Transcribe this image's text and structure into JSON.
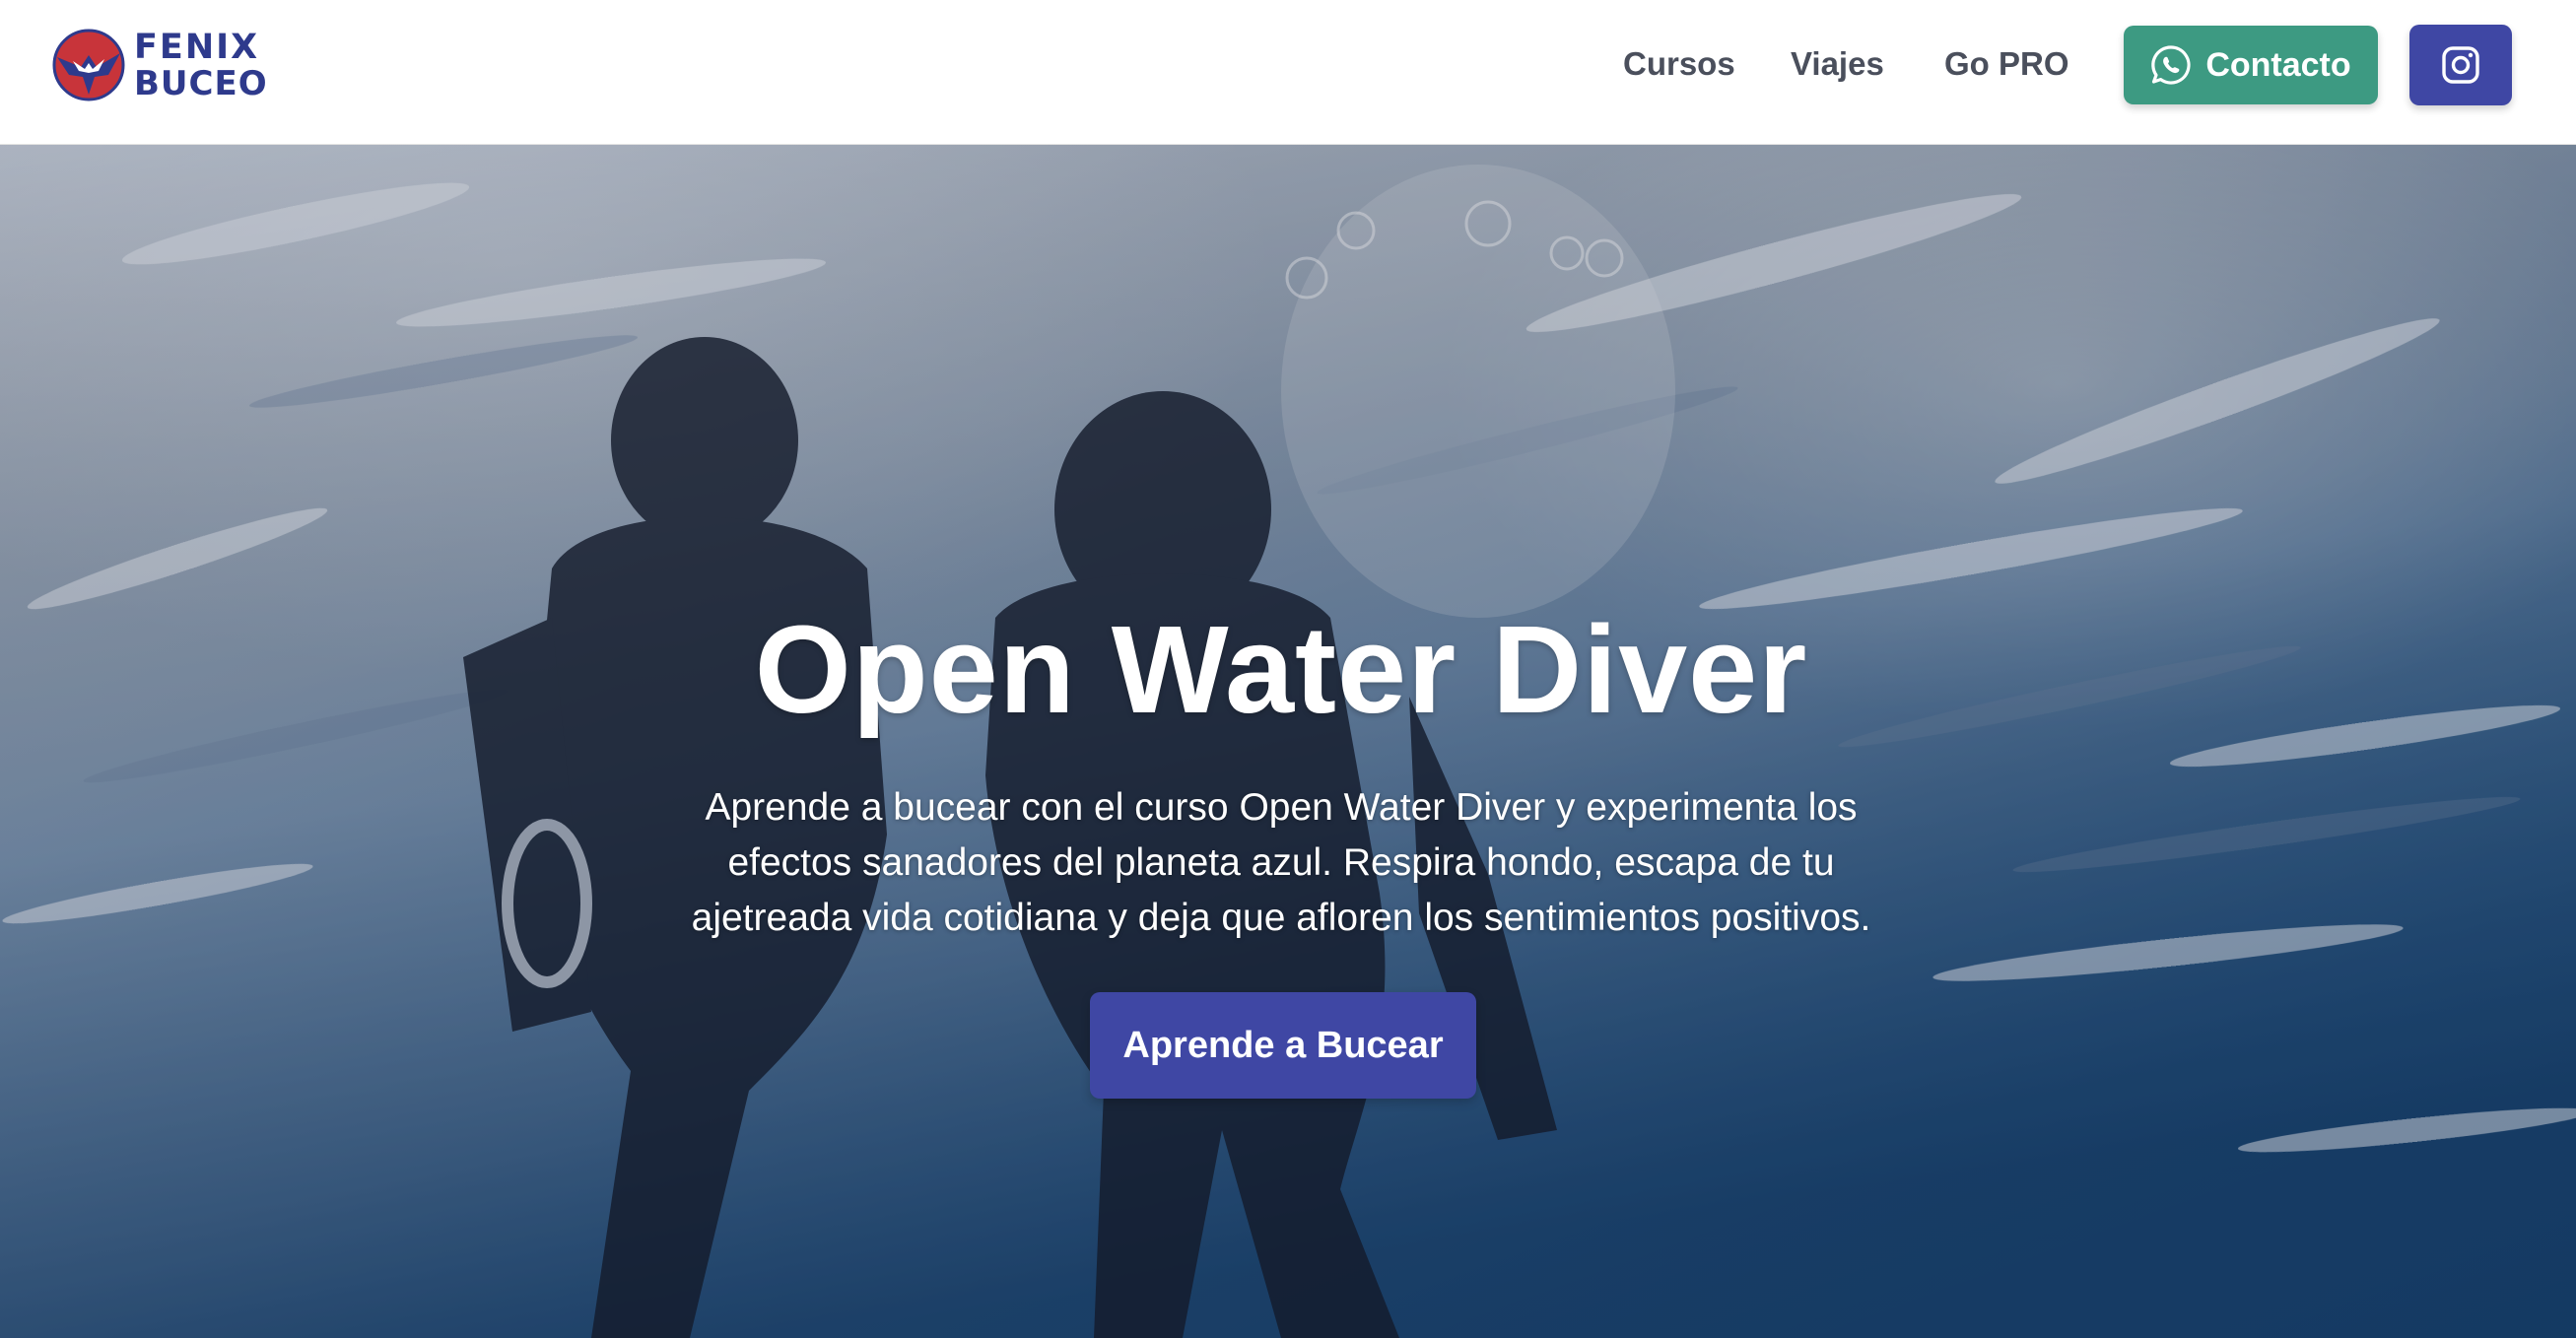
{
  "brand": {
    "line1": "FENIX",
    "line2": "BUCEO"
  },
  "nav": {
    "items": [
      {
        "label": "Cursos"
      },
      {
        "label": "Viajes"
      },
      {
        "label": "Go PRO"
      }
    ],
    "contact_label": "Contacto",
    "contact_icon": "whatsapp-icon",
    "social_icon": "instagram-icon"
  },
  "hero": {
    "title": "Open Water Diver",
    "subtitle": "Aprende a bucear con el curso Open Water Diver y experimenta los efectos sanadores del planeta azul. Respira hondo, escapa de tu ajetreada vida cotidiana y deja que afloren los sentimientos positivos.",
    "cta_label": "Aprende a Bucear"
  },
  "colors": {
    "brand_navy": "#2e3a8c",
    "brand_red": "#c8343a",
    "contact_green": "#3d9a82",
    "primary_indigo": "#3f47a4",
    "nav_text": "#4a4f5c"
  }
}
